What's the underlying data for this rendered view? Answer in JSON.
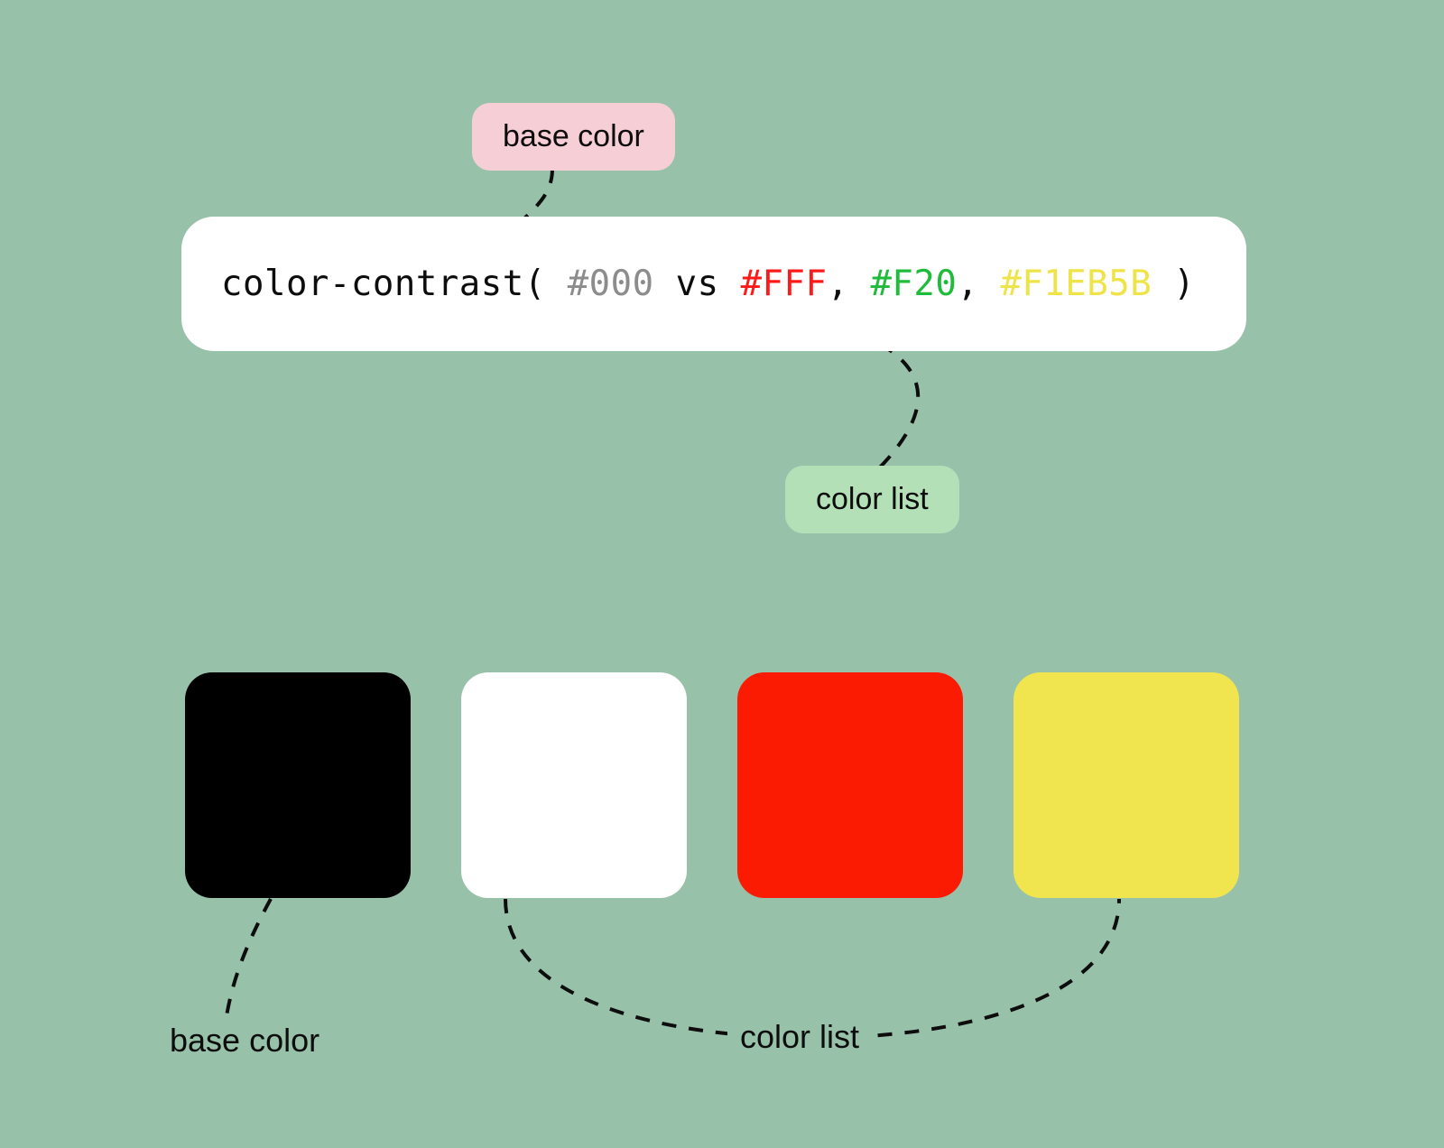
{
  "callouts": {
    "top": {
      "label": "base color",
      "style": "callout-pink"
    },
    "right": {
      "label": "color list",
      "style": "callout-green"
    }
  },
  "code": {
    "fn": "color-contrast",
    "base": "#000",
    "vs": "vs",
    "c1": "#FFF",
    "c2": "#F20",
    "c3": "#F1EB5B"
  },
  "swatches": {
    "base": "#000000",
    "c1": "#ffffff",
    "c2": "#fa1b02",
    "c3": "#f0e54f"
  },
  "bottom_labels": {
    "base": "base color",
    "list": "color list"
  }
}
